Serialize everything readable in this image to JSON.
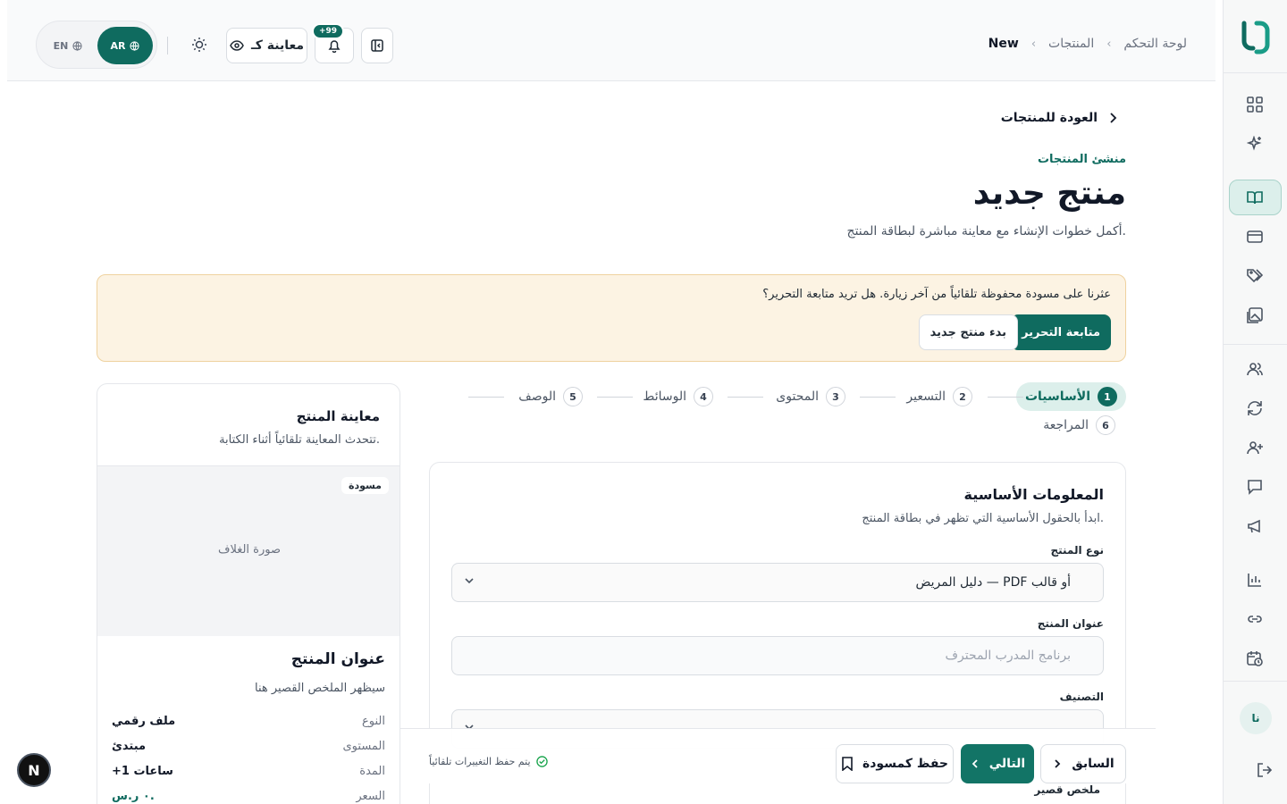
{
  "breadcrumb": {
    "items": [
      "لوحة التحكم",
      "المنتجات",
      "New"
    ]
  },
  "topbar": {
    "preview_label": "معاينة كـ",
    "notif_badge": "+99",
    "lang_ar": "AR",
    "lang_en": "EN"
  },
  "page": {
    "back_label": "العودة للمنتجات",
    "eyebrow": "منشئ المنتجات",
    "title": "منتج جديد",
    "subtitle": "أكمل خطوات الإنشاء مع معاينة مباشرة لبطاقة المنتج."
  },
  "draft_banner": {
    "message": "عثرنا على مسودة محفوظة تلقائياً من آخر زيارة. هل تريد متابعة التحرير؟",
    "continue_label": "متابعة التحرير",
    "new_label": "بدء منتج جديد"
  },
  "steps": [
    {
      "num": "1",
      "label": "الأساسيات",
      "active": true
    },
    {
      "num": "2",
      "label": "التسعير"
    },
    {
      "num": "3",
      "label": "المحتوى"
    },
    {
      "num": "4",
      "label": "الوسائط"
    },
    {
      "num": "5",
      "label": "الوصف"
    },
    {
      "num": "6",
      "label": "المراجعة"
    }
  ],
  "form": {
    "heading": "المعلومات الأساسية",
    "description": "ابدأ بالحقول الأساسية التي تظهر في بطاقة المنتج.",
    "type_label": "نوع المنتج",
    "type_value": "دليل المريض — PDF أو قالب",
    "title_label": "عنوان المنتج",
    "title_placeholder": "برنامج المدرب المحترف",
    "category_label": "التصنيف",
    "summary_label": "ملخص قصير"
  },
  "footer": {
    "autosave": "يتم حفظ التغييرات تلقائياً",
    "prev_label": "السابق",
    "next_label": "التالي",
    "save_label": "حفظ كمسودة"
  },
  "preview": {
    "title": "معاينة المنتج",
    "subtitle": "تتحدث المعاينة تلقائياً أثناء الكتابة.",
    "badge": "مسودة",
    "cover_label": "صورة الغلاف",
    "product_title": "عنوان المنتج",
    "product_summary": "سيظهر الملخص القصير هنا",
    "rows": [
      {
        "k": "النوع",
        "v": "ملف رقمي"
      },
      {
        "k": "المستوى",
        "v": "مبتدئ"
      },
      {
        "k": "المدة",
        "v": "+1 ساعات"
      },
      {
        "k": "السعر",
        "v": "٠ ر.س."
      }
    ]
  },
  "user": {
    "initials": "نا"
  },
  "colors": {
    "primary": "#0f6b5f",
    "banner_bg": "#fcf3e3",
    "active_step_bg": "#dcefeb"
  },
  "icons": {
    "rail": [
      "grid-icon",
      "sparkles-icon",
      "book-open-icon",
      "credit-card-icon",
      "tags-icon",
      "images-icon",
      "users-icon",
      "refresh-icon",
      "user-plus-icon",
      "message-icon",
      "megaphone-icon",
      "bar-chart-icon",
      "link-icon",
      "calendar-clock-icon",
      "logout-icon"
    ]
  }
}
